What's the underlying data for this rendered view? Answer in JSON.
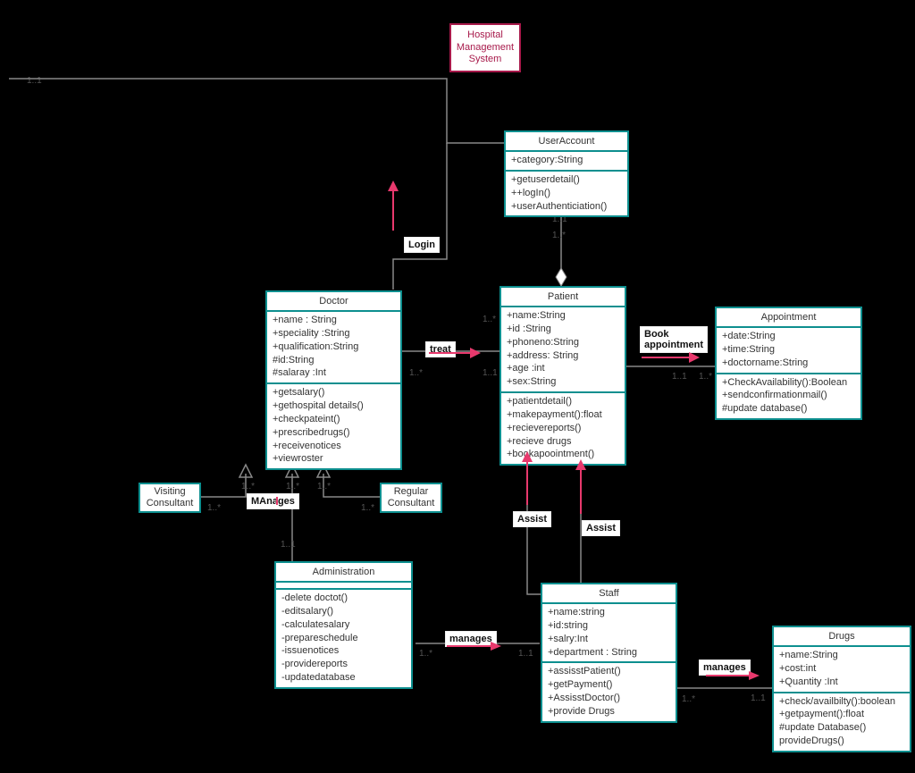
{
  "title": "Hospital\nManagement\nSystem",
  "classes": {
    "userAccount": {
      "name": "UserAccount",
      "attrs": [
        "+category:String"
      ],
      "ops": [
        "+getuserdetail()",
        "++logIn()",
        "+userAuthenticiation()"
      ]
    },
    "doctor": {
      "name": "Doctor",
      "attrs": [
        "+name : String",
        "+speciality :String",
        "+qualification:String",
        "#id:String",
        "#salaray :Int"
      ],
      "ops": [
        "+getsalary()",
        "+gethospital details()",
        "+checkpateint()",
        "+prescribedrugs()",
        "+receivenotices",
        "+viewroster"
      ]
    },
    "patient": {
      "name": "Patient",
      "attrs": [
        "+name:String",
        "+id :String",
        "+phoneno:String",
        "+address: String",
        "+age :int",
        "+sex:String"
      ],
      "ops": [
        "+patientdetail()",
        "+makepayment():float",
        "+recievereports()",
        "+recieve drugs",
        "+bookapoointment()"
      ]
    },
    "appointment": {
      "name": "Appointment",
      "attrs": [
        "+date:String",
        "+time:String",
        "+doctorname:String"
      ],
      "ops": [
        "+CheckAvailability():Boolean",
        "+sendconfirmationmail()",
        "#update database()"
      ]
    },
    "administration": {
      "name": "Administration",
      "attrs": [],
      "ops": [
        "-delete doctot()",
        "-editsalary()",
        "-calculatesalary",
        "-prepareschedule",
        "-issuenotices",
        "-providereports",
        "-updatedatabase"
      ]
    },
    "staff": {
      "name": "Staff",
      "attrs": [
        "+name:string",
        "+id:string",
        "+salry:Int",
        "+department : String"
      ],
      "ops": [
        "+assisstPatient()",
        "+getPayment()",
        "+AssisstDoctor()",
        "+provide Drugs"
      ]
    },
    "drugs": {
      "name": "Drugs",
      "attrs": [
        "+name:String",
        "+cost:int",
        "+Quantity :Int"
      ],
      "ops": [
        "+check/availbilty():boolean",
        "+getpayment():float",
        "#update Database()",
        "provideDrugs()"
      ]
    }
  },
  "simple": {
    "visiting": "Visiting\nConsultant",
    "regular": "Regular\nConsultant"
  },
  "labels": {
    "login": "Login",
    "treat": "treat",
    "book": "Book\nappointment",
    "manages1": "MAnages",
    "assist1": "Assist",
    "assist2": "Assist",
    "manages2": "manages",
    "manages3": "manages"
  },
  "mults": {
    "m1": "1..1",
    "m2": "1..1",
    "m3": "1..*",
    "m4": "1..*",
    "m5": "1..1",
    "m6": "1..*",
    "m7": "1..1",
    "m8": "1..*",
    "m9": "1..*",
    "m10": "1..*",
    "m11": "1..1",
    "m12": "1..1",
    "m13": "1..1",
    "m14": "1..*",
    "m15": "1..1",
    "m16": "1..*",
    "m17": "1..1"
  }
}
